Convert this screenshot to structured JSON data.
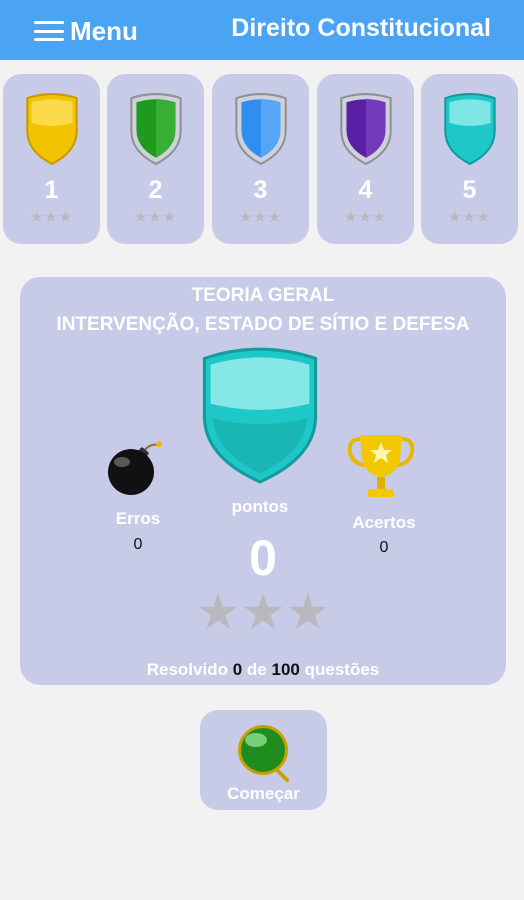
{
  "header": {
    "menu_label": "Menu",
    "title": "Direito Constitucional"
  },
  "levels": [
    {
      "number": "1",
      "stars": "★★★",
      "shield_color": "#f2c400"
    },
    {
      "number": "2",
      "stars": "★★★",
      "shield_color": "#1e9a1e"
    },
    {
      "number": "3",
      "stars": "★★★",
      "shield_color": "#2f8ff0"
    },
    {
      "number": "4",
      "stars": "★★★",
      "shield_color": "#5b1fa6"
    },
    {
      "number": "5",
      "stars": "★★★",
      "shield_color": "#1fc8c8"
    }
  ],
  "panel": {
    "category": "TEORIA GERAL",
    "topic": "INTERVENÇÃO, ESTADO DE SÍTIO E DEFESA",
    "errors_label": "Erros",
    "errors_value": "0",
    "points_label": "pontos",
    "points_value": "0",
    "correct_label": "Acertos",
    "correct_value": "0",
    "stars": "★★★",
    "resolved_prefix": "Resolvido",
    "resolved_count": "0",
    "resolved_mid": "de",
    "resolved_total": "100",
    "resolved_suffix": "questões"
  },
  "start": {
    "label": "Começar"
  },
  "colors": {
    "header": "#4aa3f3",
    "card": "#c7cbe8",
    "background": "#f2f2f2"
  }
}
